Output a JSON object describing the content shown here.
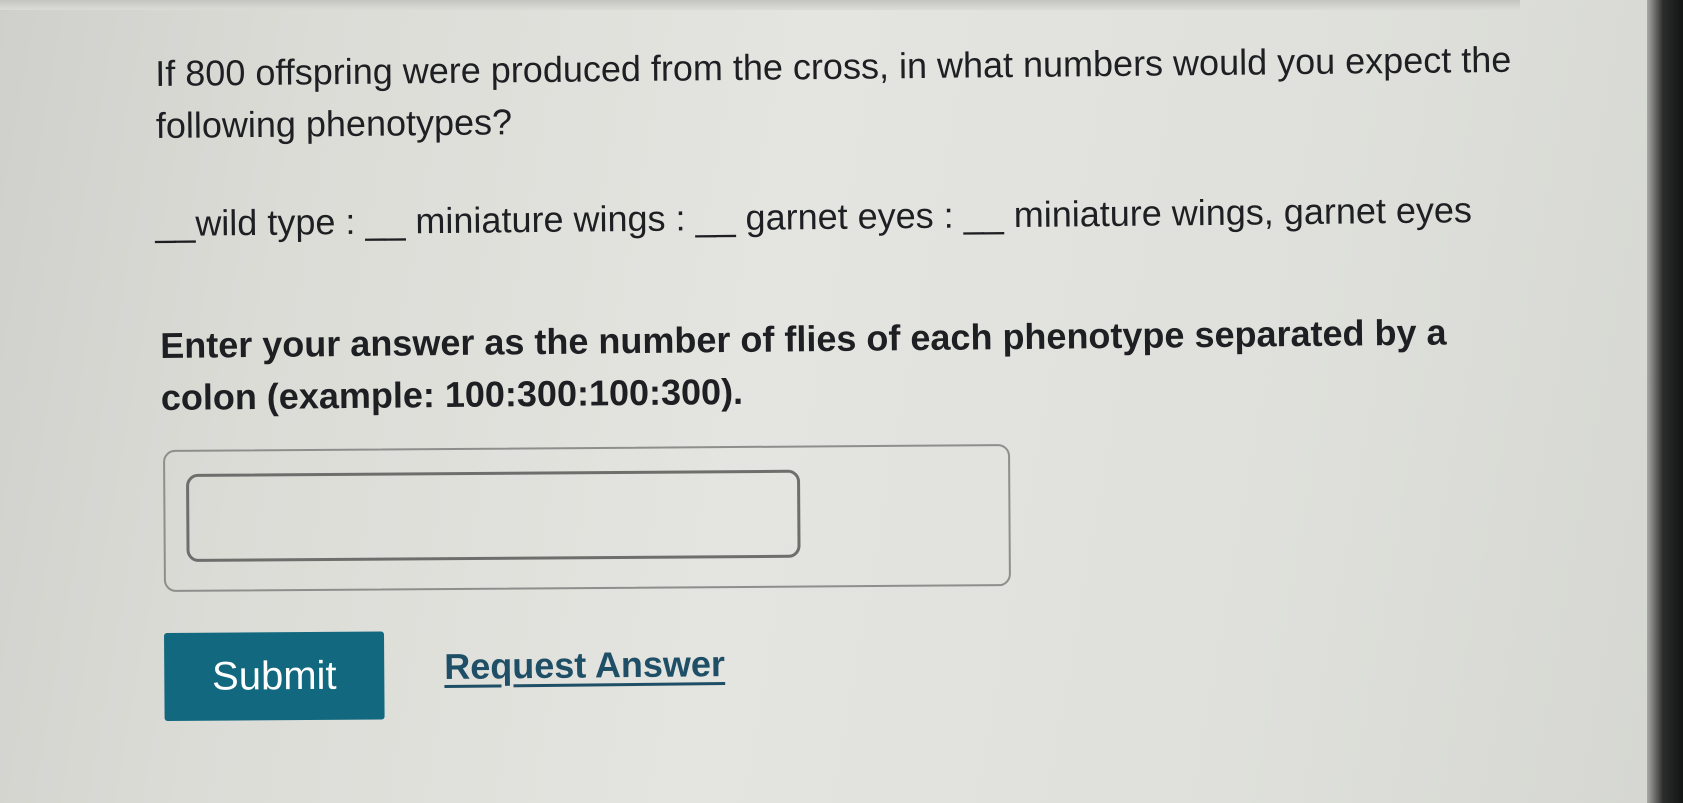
{
  "question": {
    "text": "If 800 offspring were produced from the cross, in what numbers would you expect the following phenotypes?"
  },
  "phenotypes": {
    "text": "__wild type : __ miniature wings : __ garnet eyes : __ miniature wings, garnet eyes"
  },
  "instructions": {
    "text": "Enter your answer as the number of flies of each phenotype separated by a colon (example: 100:300:100:300)."
  },
  "answer": {
    "value": "",
    "placeholder": ""
  },
  "actions": {
    "submit_label": "Submit",
    "request_answer_label": "Request Answer"
  },
  "colors": {
    "submit_button": "#12697f",
    "link": "#1f4f66",
    "text": "#1e1f22"
  }
}
